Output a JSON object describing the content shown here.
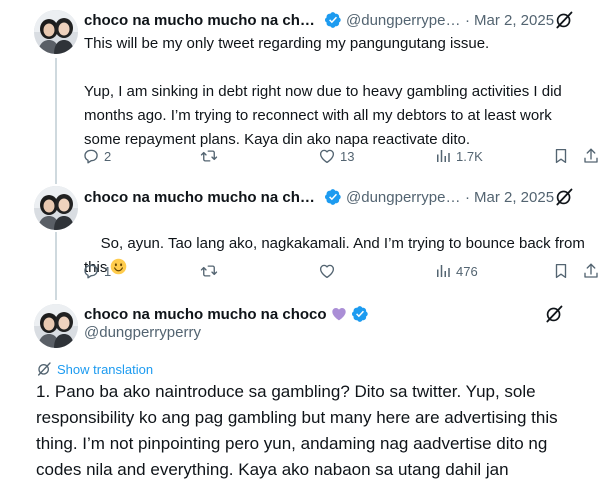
{
  "tweets": [
    {
      "author_name": "choco na mucho mucho na choco",
      "handle": "@dungperryperry",
      "date": "Mar 2, 2025",
      "dot": "·",
      "text": "This will be my only tweet regarding my pangungutang issue.\n\nYup, I am sinking in debt right now due to heavy gambling activities I did months ago. I’m trying to reconnect with all my debtors to at least work some repayment plans. Kaya din ako napa reactivate dito.",
      "replies": "2",
      "reposts": "",
      "likes": "13",
      "views": "1.7K"
    },
    {
      "author_name": "choco na mucho mucho na choco",
      "handle": "@dungperryperry",
      "date": "Mar 2, 2025",
      "dot": "·",
      "text": "So, ayun. Tao lang ako, nagkakamali. And I’m trying to bounce back from this",
      "replies": "1",
      "reposts": "",
      "likes": "",
      "views": "476"
    },
    {
      "author_name": "choco na mucho mucho na choco",
      "handle": "@dungperryperry",
      "show_translation": "Show translation",
      "text": "1. Pano ba ako naintroduce sa gambling? Dito sa twitter. Yup, sole responsibility ko ang pag gambling but many here are advertising this thing. I’m not pinpointing pero yun, andaming nag aadvertise dito ng codes nila and everything. Kaya ako nabaon sa utang dahil jan"
    }
  ],
  "colors": {
    "verified": "#1d9bf0",
    "link": "#1d9bf0",
    "secondary_text": "#536471",
    "primary_text": "#0f1419",
    "heart_emoji": "#aa8ed6"
  },
  "icons": {
    "reply": "reply-icon",
    "repost": "repost-icon",
    "like": "like-icon",
    "views": "views-icon",
    "bookmark": "bookmark-icon",
    "share": "share-icon",
    "grok": "grok-icon",
    "verified": "verified-badge-icon",
    "translate": "translate-icon"
  }
}
